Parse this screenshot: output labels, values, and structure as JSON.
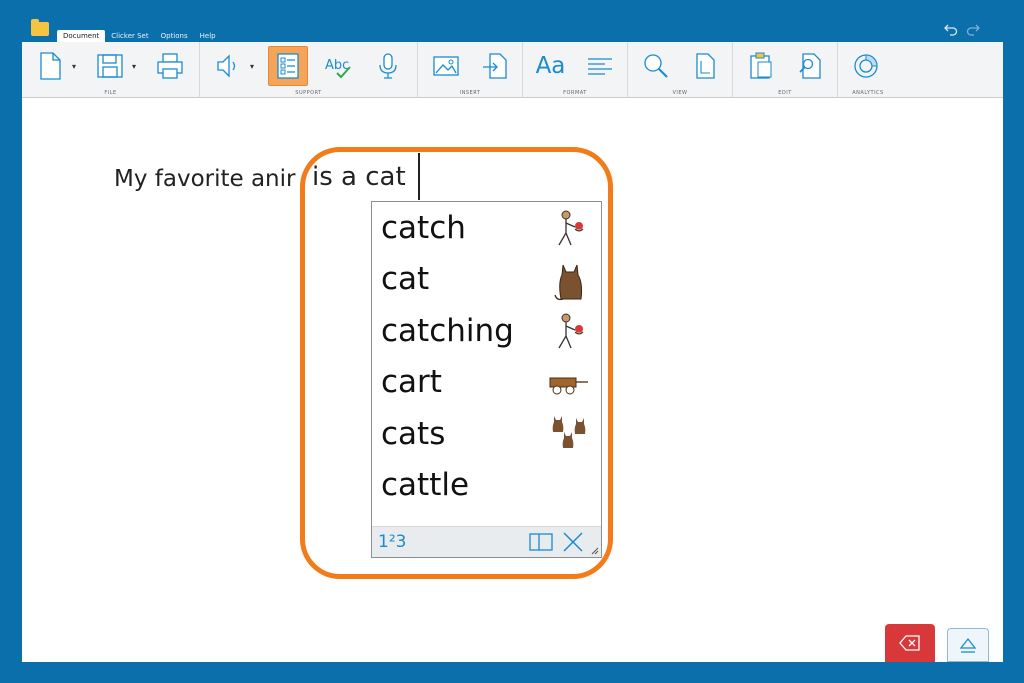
{
  "menu": {
    "tabs": [
      {
        "label": "Document",
        "active": true
      },
      {
        "label": "Clicker Set",
        "active": false
      },
      {
        "label": "Options",
        "active": false
      },
      {
        "label": "Help",
        "active": false
      }
    ]
  },
  "ribbon": {
    "groups": {
      "file": "FILE",
      "support": "SUPPORT",
      "insert": "INSERT",
      "format": "FORMAT",
      "view": "VIEW",
      "edit": "EDIT",
      "analytics": "ANALYTICS"
    },
    "format_font_label": "Aa"
  },
  "document": {
    "text": "My favorite anir",
    "overlay_text": "is a cat"
  },
  "predictor": {
    "words": [
      "catch",
      "cat",
      "catching",
      "cart",
      "cats",
      "cattle"
    ],
    "number_button": "1²3"
  },
  "colors": {
    "frame": "#0b6fab",
    "highlight": "#f27b1a",
    "accent": "#1a8bd0",
    "delete": "#d9383a"
  }
}
